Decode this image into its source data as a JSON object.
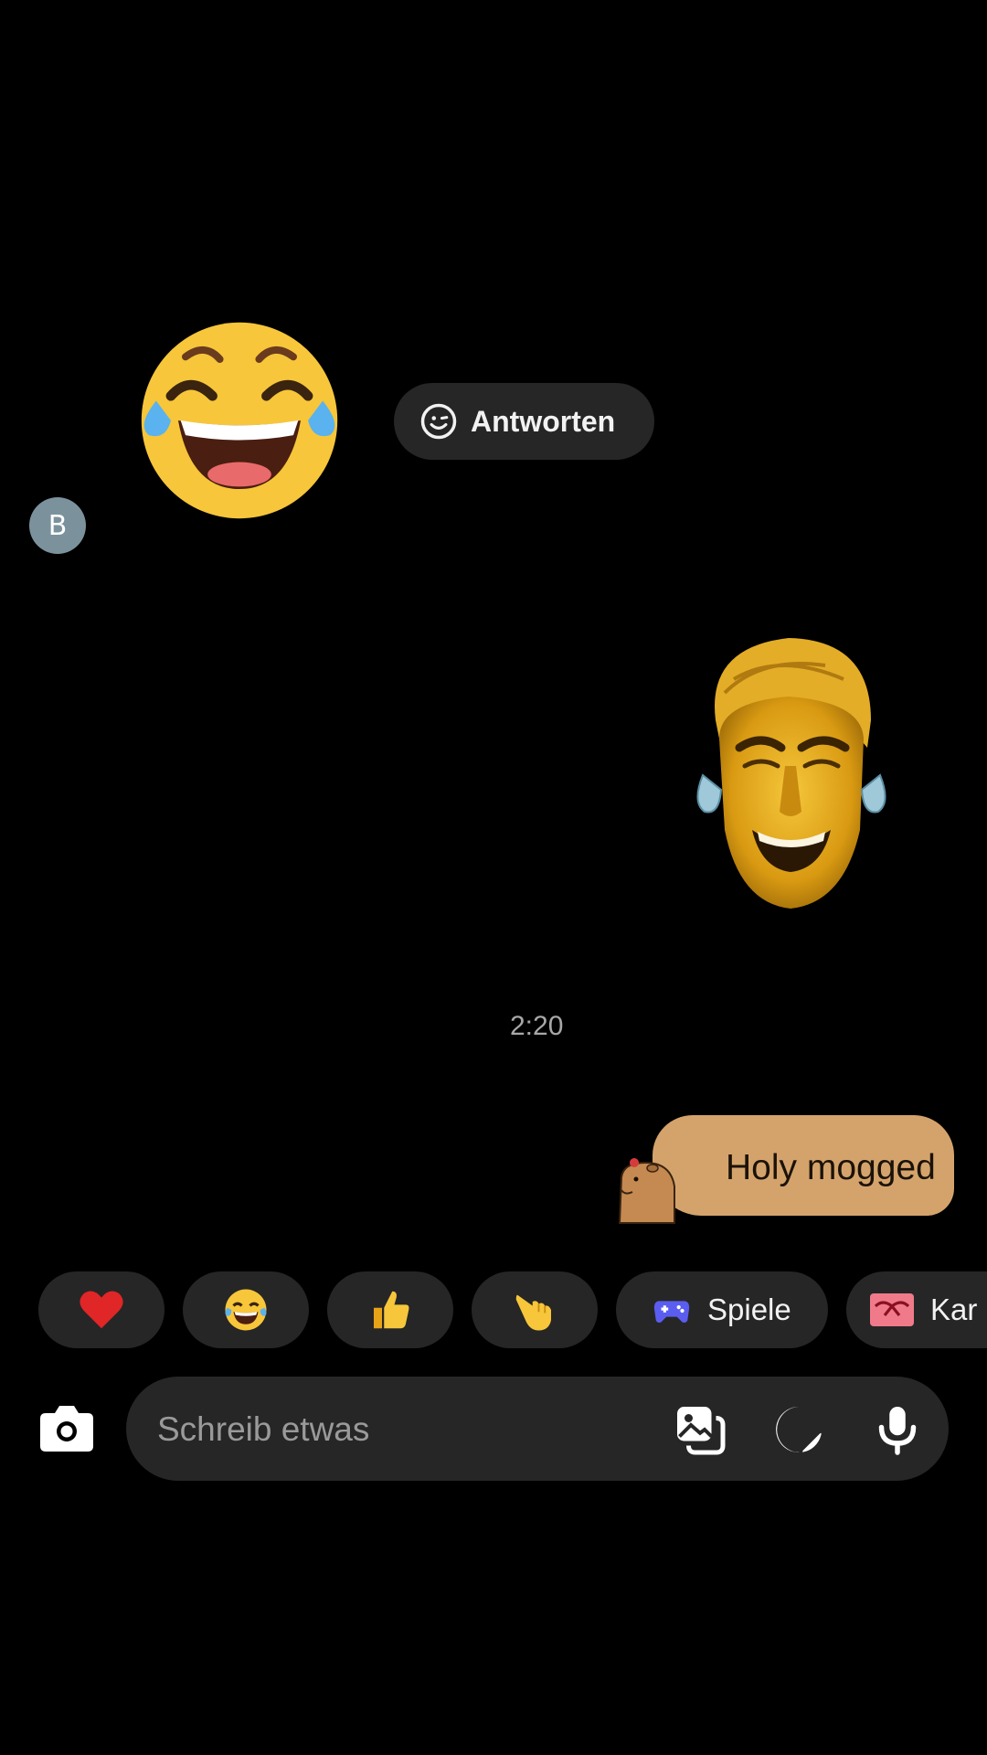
{
  "incoming": {
    "avatar_initial": "B",
    "emoji_name": "face-with-tears-of-joy",
    "reply_label": "Antworten"
  },
  "outgoing": {
    "sticker_name": "crying-laughing-gigachad-sticker",
    "message_text": "Holy mogged"
  },
  "timestamp": "2:20",
  "quick_replies": {
    "emoji_chips": [
      "heart",
      "face-with-tears-of-joy",
      "thumbs-up",
      "pointing-hand"
    ],
    "games_label": "Spiele",
    "cards_label": "Kar"
  },
  "composer": {
    "placeholder": "Schreib etwas"
  },
  "colors": {
    "background": "#000000",
    "chip_bg": "#262626",
    "bubble_bg": "#d4a36c",
    "avatar_bg": "#7b929c",
    "emoji_yellow": "#f7c63a",
    "games_icon": "#5b5df0",
    "cards_icon": "#f07a8a"
  }
}
